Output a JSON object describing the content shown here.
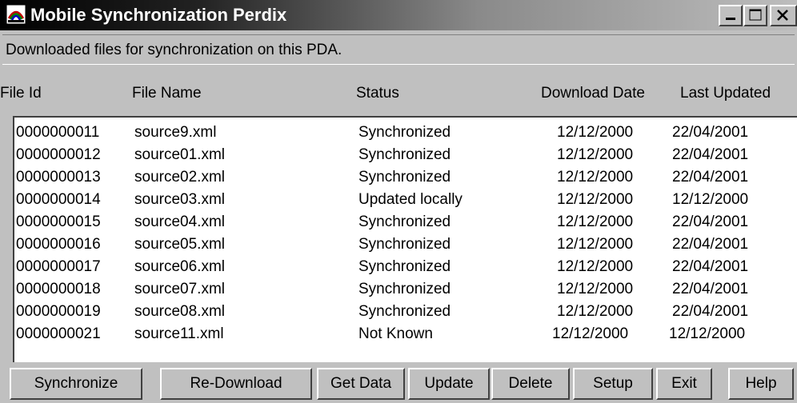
{
  "window": {
    "title": "Mobile Synchronization Perdix",
    "app_icon": "rainbow-app-icon",
    "controls": [
      "minimize-icon",
      "maximize-icon",
      "close-icon"
    ]
  },
  "subtitle": "Downloaded files for synchronization on this PDA.",
  "columns": {
    "file_id": "File Id",
    "file_name": "File Name",
    "status": "Status",
    "download_date": "Download Date",
    "last_updated": "Last Updated"
  },
  "rows": [
    {
      "file_id": "0000000011",
      "file_name": "source9.xml",
      "status": "Synchronized",
      "download_date": "12/12/2000",
      "last_updated": "22/04/2001"
    },
    {
      "file_id": "0000000012",
      "file_name": "source01.xml",
      "status": "Synchronized",
      "download_date": "12/12/2000",
      "last_updated": "22/04/2001"
    },
    {
      "file_id": "0000000013",
      "file_name": "source02.xml",
      "status": "Synchronized",
      "download_date": "12/12/2000",
      "last_updated": "22/04/2001"
    },
    {
      "file_id": "0000000014",
      "file_name": "source03.xml",
      "status": "Updated locally",
      "download_date": "12/12/2000",
      "last_updated": "12/12/2000"
    },
    {
      "file_id": "0000000015",
      "file_name": "source04.xml",
      "status": "Synchronized",
      "download_date": "12/12/2000",
      "last_updated": "22/04/2001"
    },
    {
      "file_id": "0000000016",
      "file_name": "source05.xml",
      "status": "Synchronized",
      "download_date": "12/12/2000",
      "last_updated": "22/04/2001"
    },
    {
      "file_id": "0000000017",
      "file_name": "source06.xml",
      "status": "Synchronized",
      "download_date": "12/12/2000",
      "last_updated": "22/04/2001"
    },
    {
      "file_id": "0000000018",
      "file_name": "source07.xml",
      "status": "Synchronized",
      "download_date": "12/12/2000",
      "last_updated": "22/04/2001"
    },
    {
      "file_id": "0000000019",
      "file_name": "source08.xml",
      "status": "Synchronized",
      "download_date": "12/12/2000",
      "last_updated": "22/04/2001"
    },
    {
      "file_id": "0000000021",
      "file_name": "source11.xml",
      "status": "Not Known",
      "download_date": "12/12/2000",
      "last_updated": "12/12/2000"
    }
  ],
  "buttons": {
    "synchronize": "Synchronize",
    "redownload": "Re-Download",
    "get_data": "Get Data",
    "update": "Update",
    "delete": "Delete",
    "setup": "Setup",
    "exit": "Exit",
    "help": "Help"
  },
  "colors": {
    "face": "#c0c0c0",
    "title_start": "#000000",
    "title_end": "#bdbdbd",
    "list_bg": "#ffffff"
  }
}
